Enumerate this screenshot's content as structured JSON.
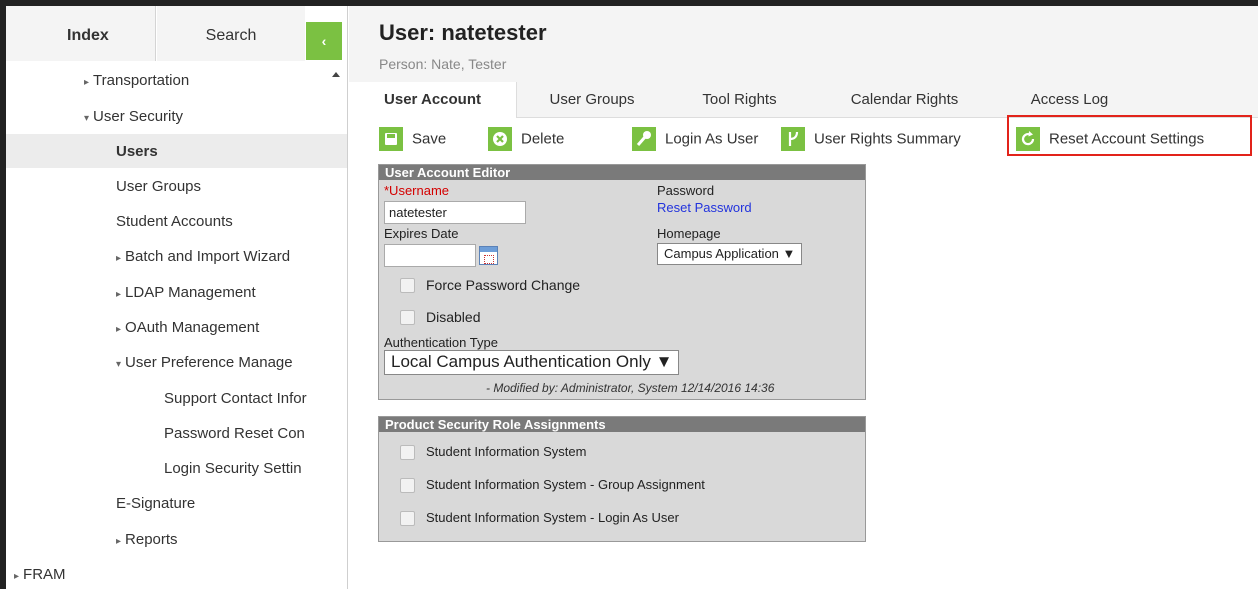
{
  "left_panel": {
    "tabs": {
      "index": "Index",
      "search": "Search"
    },
    "collapse_glyph": "‹",
    "tree": [
      {
        "label": "Transportation",
        "arrow": "▸"
      },
      {
        "label": "User Security",
        "arrow": "▾"
      },
      {
        "label": "Users",
        "arrow": ""
      },
      {
        "label": "User Groups",
        "arrow": ""
      },
      {
        "label": "Student Accounts",
        "arrow": ""
      },
      {
        "label": "Batch and Import Wizard",
        "arrow": "▸"
      },
      {
        "label": "LDAP Management",
        "arrow": "▸"
      },
      {
        "label": "OAuth Management",
        "arrow": "▸"
      },
      {
        "label": "User Preference Manage",
        "arrow": "▾"
      },
      {
        "label": "Support Contact Infor",
        "arrow": ""
      },
      {
        "label": "Password Reset Con",
        "arrow": ""
      },
      {
        "label": "Login Security Settin",
        "arrow": ""
      },
      {
        "label": "E-Signature",
        "arrow": ""
      },
      {
        "label": "Reports",
        "arrow": "▸"
      },
      {
        "label": "FRAM",
        "arrow": "▸"
      }
    ]
  },
  "header": {
    "title": "User: natetester",
    "subtitle": "Person: Nate, Tester"
  },
  "tabs": [
    "User Account",
    "User Groups",
    "Tool Rights",
    "Calendar Rights",
    "Access Log"
  ],
  "toolbar": {
    "save": "Save",
    "delete": "Delete",
    "login_as_user": "Login As User",
    "user_rights_summary": "User Rights Summary",
    "reset_account_settings": "Reset Account Settings"
  },
  "editor": {
    "title": "User Account Editor",
    "username_label": "*Username",
    "username_value": "natetester",
    "password_label": "Password",
    "reset_password_link": "Reset Password",
    "expires_label": "Expires Date",
    "expires_value": "",
    "homepage_label": "Homepage",
    "homepage_value": "Campus Application ▼",
    "force_password_change": "Force Password Change",
    "disabled": "Disabled",
    "auth_type_label": "Authentication Type",
    "auth_type_value": "Local Campus Authentication Only ▼",
    "modified": "- Modified by: Administrator, System 12/14/2016 14:36"
  },
  "product_security": {
    "title": "Product Security Role Assignments",
    "items": [
      "Student Information System",
      "Student Information System - Group Assignment",
      "Student Information System - Login As User"
    ]
  },
  "colors": {
    "accent_green": "#7bc142",
    "highlight_red": "#e2231a",
    "link_blue": "#2233dd",
    "required_red": "#d40000"
  }
}
